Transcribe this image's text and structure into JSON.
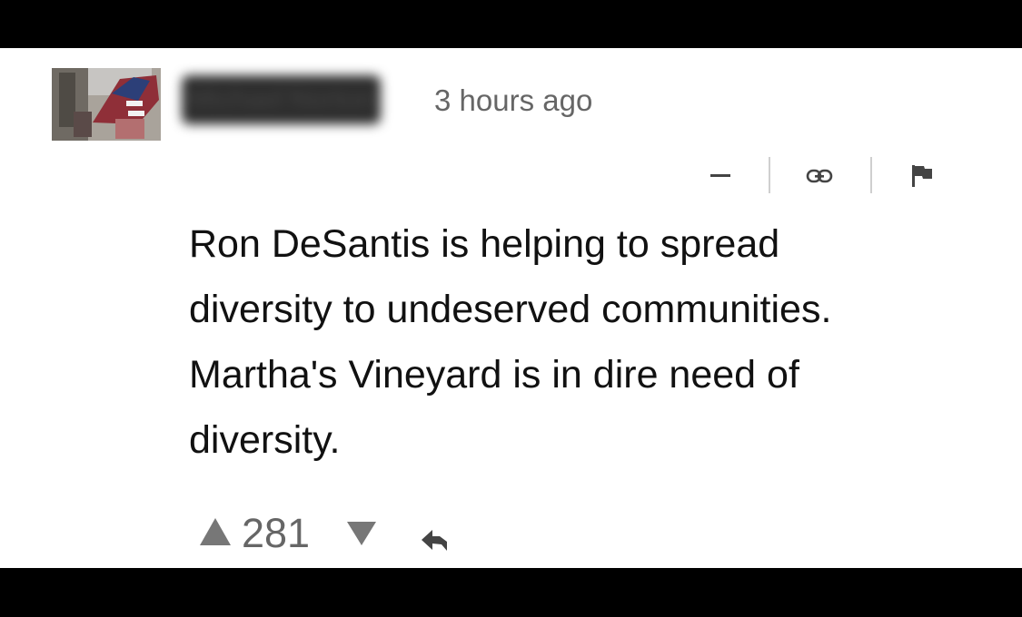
{
  "comment": {
    "author": "Michael Norton",
    "timestamp": "3 hours ago",
    "body": "Ron DeSantis is helping to spread\ndiversity to undeserved communities.\nMartha's Vineyard is in dire need of\ndiversity.",
    "score": "281"
  },
  "icons": {
    "collapse": "minus-icon",
    "link": "link-icon",
    "flag": "flag-icon",
    "upvote": "upvote-arrow-icon",
    "downvote": "downvote-arrow-icon",
    "reply": "reply-icon"
  },
  "colors": {
    "text": "#111111",
    "muted": "#666666",
    "separator": "#cfcfcf",
    "letterbox": "#000000"
  }
}
